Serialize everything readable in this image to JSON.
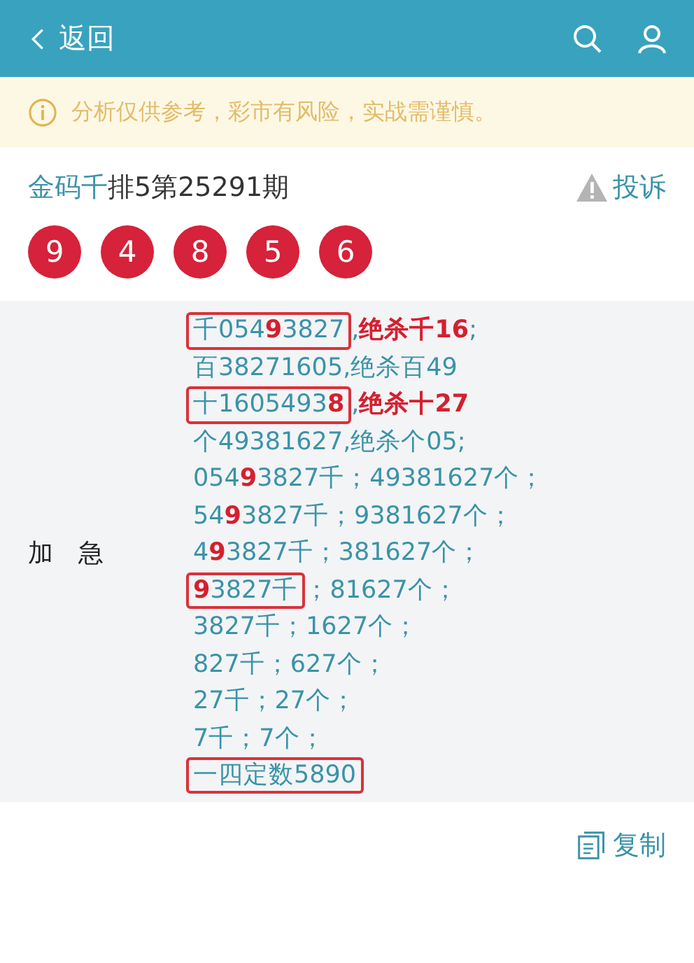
{
  "header": {
    "back_label": "返回"
  },
  "notice": {
    "text": "分析仅供参考，彩市有风险，实战需谨慎。"
  },
  "title": {
    "source": "金码千",
    "issue": "排5第25291期"
  },
  "report_link": "投诉",
  "balls": [
    "9",
    "4",
    "8",
    "5",
    "6"
  ],
  "analysis": {
    "label": "加　急",
    "lines": [
      {
        "boxed": "千054**9**3827",
        "text": ",**绝杀千16**;"
      },
      {
        "text": "百38271605,绝杀百49"
      },
      {
        "boxed": "十1605493**8**",
        "text": ",**绝杀十27**"
      },
      {
        "text": "个49381627,绝杀个05;"
      },
      {
        "text": "054**9**3827千；49381627个；"
      },
      {
        "text": "54**9**3827千；9381627个；"
      },
      {
        "text": "4**9**3827千；381627个；"
      },
      {
        "boxed": "**9**3827千",
        "text": "；81627个；"
      },
      {
        "text": "3827千；1627个；"
      },
      {
        "text": "827千；627个；"
      },
      {
        "text": "27千；27个；"
      },
      {
        "text": "7千；7个；"
      },
      {
        "boxed": "一四定数5890"
      }
    ]
  },
  "copy_button": "复制"
}
